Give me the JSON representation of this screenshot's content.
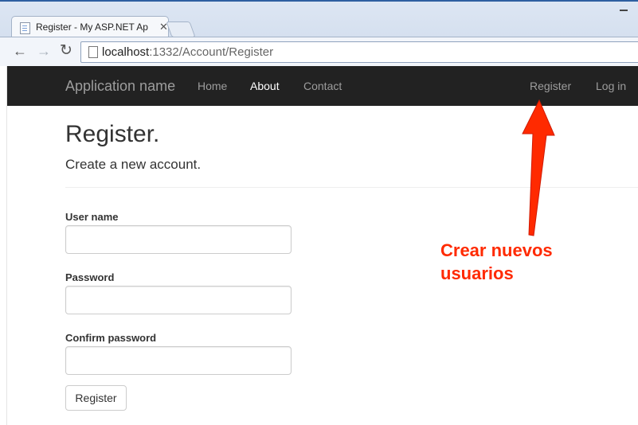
{
  "browser": {
    "tab_title": "Register - My ASP.NET Ap",
    "url_host": "localhost",
    "url_path": ":1332/Account/Register",
    "icons": {
      "back": "arrow-left-icon",
      "forward": "arrow-right-icon",
      "reload": "reload-icon",
      "close": "close-icon"
    }
  },
  "navbar": {
    "brand": "Application name",
    "links": [
      {
        "label": "Home",
        "active": false
      },
      {
        "label": "About",
        "active": true
      },
      {
        "label": "Contact",
        "active": false
      }
    ],
    "right_links": [
      {
        "label": "Register"
      },
      {
        "label": "Log in"
      }
    ]
  },
  "page": {
    "title": "Register.",
    "subtitle": "Create a new account.",
    "form": {
      "fields": [
        {
          "label": "User name",
          "value": ""
        },
        {
          "label": "Password",
          "value": ""
        },
        {
          "label": "Confirm password",
          "value": ""
        }
      ],
      "submit_label": "Register"
    }
  },
  "annotation": {
    "lines": [
      "Crear nuevos",
      "usuarios"
    ],
    "color": "#ff2a00"
  },
  "colors": {
    "navbar_bg": "#222222",
    "nav_text": "#9d9d9d",
    "nav_active": "#ffffff"
  }
}
